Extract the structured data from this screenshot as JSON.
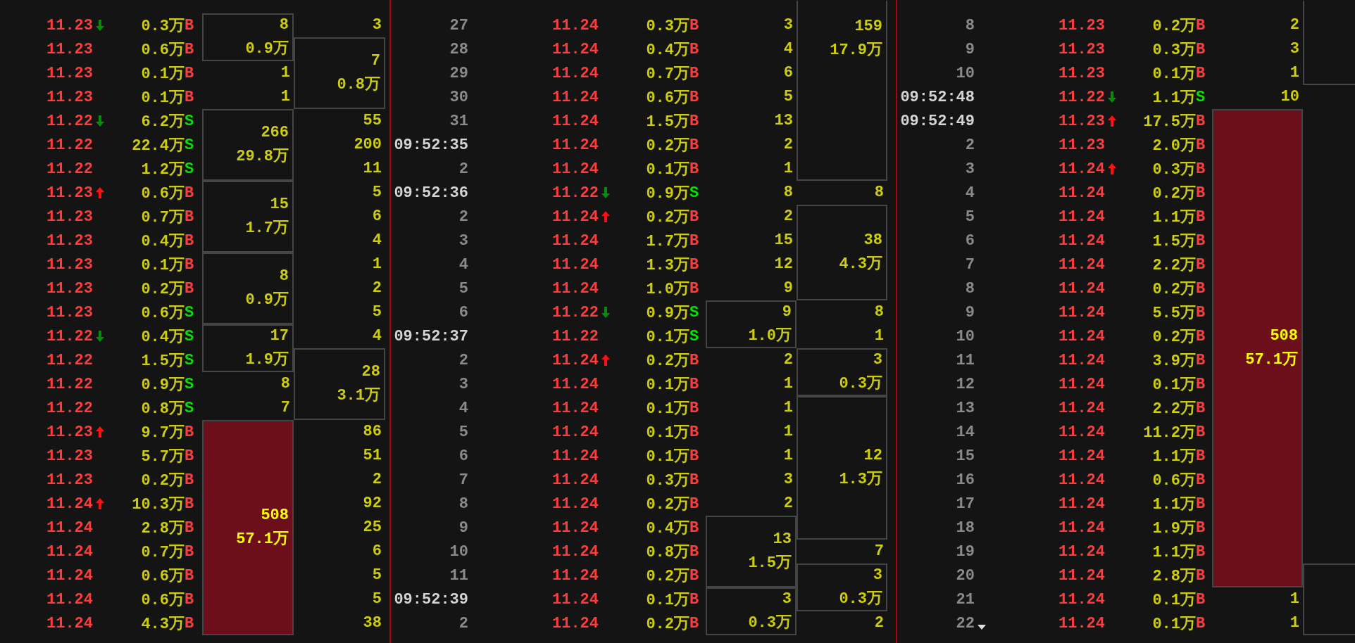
{
  "panels": [
    {
      "rows": [
        {
          "price": "11.23",
          "down_tick": true,
          "volume": "0.3万",
          "side": "B",
          "kind": "buy",
          "column_1": {
            "kind": "box",
            "count": "8",
            "amount": "0.9万"
          },
          "column_2": {
            "kind": "plain",
            "count": "3"
          }
        },
        {
          "price": "11.23",
          "volume": "0.6万",
          "side": "B",
          "kind": "buy",
          "column_2": {
            "kind": "box",
            "count": "7",
            "amount": "0.8万"
          }
        },
        {
          "price": "11.23",
          "volume": "0.1万",
          "side": "B",
          "kind": "buy",
          "column_1": {
            "kind": "plain",
            "count": "1"
          }
        },
        {
          "price": "11.23",
          "volume": "0.1万",
          "side": "B",
          "kind": "buy",
          "column_1": {
            "kind": "plain",
            "count": "1"
          }
        },
        {
          "price": "11.22",
          "down_tick": true,
          "volume": "6.2万",
          "side": "S",
          "kind": "sell",
          "column_1": {
            "kind": "box",
            "count": "266",
            "amount": "29.8万"
          },
          "column_2": {
            "kind": "plain",
            "count": "55"
          }
        },
        {
          "price": "11.22",
          "volume": "22.4万",
          "side": "S",
          "kind": "sell",
          "column_2": {
            "kind": "plain",
            "count": "200"
          }
        },
        {
          "price": "11.22",
          "volume": "1.2万",
          "side": "S",
          "kind": "sell",
          "column_2": {
            "kind": "plain",
            "count": "11"
          }
        },
        {
          "price": "11.23",
          "up_tick": true,
          "volume": "0.6万",
          "side": "B",
          "kind": "buy",
          "column_1": {
            "kind": "box",
            "count": "15",
            "amount": "1.7万"
          },
          "column_2": {
            "kind": "plain",
            "count": "5"
          }
        },
        {
          "price": "11.23",
          "volume": "0.7万",
          "side": "B",
          "kind": "buy",
          "column_2": {
            "kind": "plain",
            "count": "6"
          }
        },
        {
          "price": "11.23",
          "volume": "0.4万",
          "side": "B",
          "kind": "buy",
          "column_2": {
            "kind": "plain",
            "count": "4"
          }
        },
        {
          "price": "11.23",
          "volume": "0.1万",
          "side": "B",
          "kind": "buy",
          "column_1": {
            "kind": "box",
            "count": "8",
            "amount": "0.9万"
          },
          "column_2": {
            "kind": "plain",
            "count": "1"
          }
        },
        {
          "price": "11.23",
          "volume": "0.2万",
          "side": "B",
          "kind": "buy",
          "column_2": {
            "kind": "plain",
            "count": "2"
          }
        },
        {
          "price": "11.23",
          "volume": "0.6万",
          "side": "S",
          "kind": "sell",
          "column_2": {
            "kind": "plain",
            "count": "5"
          }
        },
        {
          "price": "11.22",
          "down_tick": true,
          "volume": "0.4万",
          "side": "S",
          "kind": "sell",
          "column_1": {
            "kind": "box",
            "count": "17",
            "amount": "1.9万"
          },
          "column_2": {
            "kind": "plain",
            "count": "4"
          }
        },
        {
          "price": "11.22",
          "volume": "1.5万",
          "side": "S",
          "kind": "sell",
          "column_2": {
            "kind": "box",
            "count": "28",
            "amount": "3.1万"
          }
        },
        {
          "price": "11.22",
          "volume": "0.9万",
          "side": "S",
          "kind": "sell",
          "column_1": {
            "kind": "plain",
            "count": "8"
          }
        },
        {
          "price": "11.22",
          "volume": "0.8万",
          "side": "S",
          "kind": "sell",
          "column_1": {
            "kind": "plain",
            "count": "7"
          }
        },
        {
          "price": "11.23",
          "up_tick": true,
          "volume": "9.7万",
          "side": "B",
          "kind": "buy",
          "column_1": {
            "kind": "highlight",
            "count": "508",
            "amount": "57.1万"
          },
          "column_2": {
            "kind": "plain",
            "count": "86"
          }
        },
        {
          "price": "11.23",
          "volume": "5.7万",
          "side": "B",
          "kind": "buy",
          "column_2": {
            "kind": "plain",
            "count": "51"
          }
        },
        {
          "price": "11.23",
          "volume": "0.2万",
          "side": "B",
          "kind": "buy",
          "column_2": {
            "kind": "plain",
            "count": "2"
          }
        },
        {
          "price": "11.24",
          "up_tick": true,
          "volume": "10.3万",
          "side": "B",
          "kind": "buy",
          "column_2": {
            "kind": "plain",
            "count": "92"
          }
        },
        {
          "price": "11.24",
          "volume": "2.8万",
          "side": "B",
          "kind": "buy",
          "column_2": {
            "kind": "plain",
            "count": "25"
          }
        },
        {
          "price": "11.24",
          "volume": "0.7万",
          "side": "B",
          "kind": "buy",
          "column_2": {
            "kind": "plain",
            "count": "6"
          }
        },
        {
          "price": "11.24",
          "volume": "0.6万",
          "side": "B",
          "kind": "buy",
          "column_2": {
            "kind": "plain",
            "count": "5"
          }
        },
        {
          "price": "11.24",
          "volume": "0.6万",
          "side": "B",
          "kind": "buy",
          "column_2": {
            "kind": "plain",
            "count": "5"
          }
        },
        {
          "price": "11.24",
          "volume": "4.3万",
          "side": "B",
          "kind": "buy",
          "column_2": {
            "kind": "plain",
            "count": "38"
          }
        }
      ]
    },
    {
      "rows": [
        {
          "time": "27",
          "price": "11.24",
          "volume": "0.3万",
          "side": "B",
          "kind": "buy",
          "column_1": {
            "kind": "plain",
            "count": "3"
          },
          "column_2": {
            "kind": "box",
            "count": "159",
            "amount": "17.9万",
            "continues_above": true
          }
        },
        {
          "time": "28",
          "price": "11.24",
          "volume": "0.4万",
          "side": "B",
          "kind": "buy",
          "column_1": {
            "kind": "plain",
            "count": "4"
          }
        },
        {
          "time": "29",
          "price": "11.24",
          "volume": "0.7万",
          "side": "B",
          "kind": "buy",
          "column_1": {
            "kind": "plain",
            "count": "6"
          }
        },
        {
          "time": "30",
          "price": "11.24",
          "volume": "0.6万",
          "side": "B",
          "kind": "buy",
          "column_1": {
            "kind": "plain",
            "count": "5"
          }
        },
        {
          "time": "31",
          "price": "11.24",
          "volume": "1.5万",
          "side": "B",
          "kind": "buy",
          "column_1": {
            "kind": "plain",
            "count": "13"
          }
        },
        {
          "time": "09:52:35",
          "new_second": true,
          "price": "11.24",
          "volume": "0.2万",
          "side": "B",
          "kind": "buy",
          "column_1": {
            "kind": "plain",
            "count": "2"
          }
        },
        {
          "time": "2",
          "price": "11.24",
          "volume": "0.1万",
          "side": "B",
          "kind": "buy",
          "column_1": {
            "kind": "plain",
            "count": "1"
          }
        },
        {
          "time": "09:52:36",
          "new_second": true,
          "price": "11.22",
          "down_tick": true,
          "volume": "0.9万",
          "side": "S",
          "kind": "sell",
          "column_1": {
            "kind": "plain",
            "count": "8"
          },
          "column_2": {
            "kind": "plain",
            "count": "8"
          }
        },
        {
          "time": "2",
          "price": "11.24",
          "up_tick": true,
          "volume": "0.2万",
          "side": "B",
          "kind": "buy",
          "column_1": {
            "kind": "plain",
            "count": "2"
          },
          "column_2": {
            "kind": "box",
            "count": "38",
            "amount": "4.3万"
          }
        },
        {
          "time": "3",
          "price": "11.24",
          "volume": "1.7万",
          "side": "B",
          "kind": "buy",
          "column_1": {
            "kind": "plain",
            "count": "15"
          }
        },
        {
          "time": "4",
          "price": "11.24",
          "volume": "1.3万",
          "side": "B",
          "kind": "buy",
          "column_1": {
            "kind": "plain",
            "count": "12"
          }
        },
        {
          "time": "5",
          "price": "11.24",
          "volume": "1.0万",
          "side": "B",
          "kind": "buy",
          "column_1": {
            "kind": "plain",
            "count": "9"
          }
        },
        {
          "time": "6",
          "price": "11.22",
          "down_tick": true,
          "volume": "0.9万",
          "side": "S",
          "kind": "sell",
          "column_1": {
            "kind": "box",
            "count": "9",
            "amount": "1.0万"
          },
          "column_2": {
            "kind": "plain",
            "count": "8"
          }
        },
        {
          "time": "09:52:37",
          "new_second": true,
          "price": "11.22",
          "volume": "0.1万",
          "side": "S",
          "kind": "sell",
          "column_2": {
            "kind": "plain",
            "count": "1"
          }
        },
        {
          "time": "2",
          "price": "11.24",
          "up_tick": true,
          "volume": "0.2万",
          "side": "B",
          "kind": "buy",
          "column_1": {
            "kind": "plain",
            "count": "2"
          },
          "column_2": {
            "kind": "box",
            "count": "3",
            "amount": "0.3万"
          }
        },
        {
          "time": "3",
          "price": "11.24",
          "volume": "0.1万",
          "side": "B",
          "kind": "buy",
          "column_1": {
            "kind": "plain",
            "count": "1"
          }
        },
        {
          "time": "4",
          "price": "11.24",
          "volume": "0.1万",
          "side": "B",
          "kind": "buy",
          "column_1": {
            "kind": "plain",
            "count": "1"
          },
          "column_2": {
            "kind": "box",
            "count": "12",
            "amount": "1.3万"
          }
        },
        {
          "time": "5",
          "price": "11.24",
          "volume": "0.1万",
          "side": "B",
          "kind": "buy",
          "column_1": {
            "kind": "plain",
            "count": "1"
          }
        },
        {
          "time": "6",
          "price": "11.24",
          "volume": "0.1万",
          "side": "B",
          "kind": "buy",
          "column_1": {
            "kind": "plain",
            "count": "1"
          }
        },
        {
          "time": "7",
          "price": "11.24",
          "volume": "0.3万",
          "side": "B",
          "kind": "buy",
          "column_1": {
            "kind": "plain",
            "count": "3"
          }
        },
        {
          "time": "8",
          "price": "11.24",
          "volume": "0.2万",
          "side": "B",
          "kind": "buy",
          "column_1": {
            "kind": "plain",
            "count": "2"
          }
        },
        {
          "time": "9",
          "price": "11.24",
          "volume": "0.4万",
          "side": "B",
          "kind": "buy",
          "column_1": {
            "kind": "box",
            "count": "13",
            "amount": "1.5万"
          }
        },
        {
          "time": "10",
          "price": "11.24",
          "volume": "0.8万",
          "side": "B",
          "kind": "buy",
          "column_2": {
            "kind": "plain",
            "count": "7"
          }
        },
        {
          "time": "11",
          "price": "11.24",
          "volume": "0.2万",
          "side": "B",
          "kind": "buy",
          "column_2": {
            "kind": "box",
            "count": "3",
            "amount": "0.3万"
          }
        },
        {
          "time": "09:52:39",
          "new_second": true,
          "price": "11.24",
          "volume": "0.1万",
          "side": "B",
          "kind": "buy",
          "column_1": {
            "kind": "box",
            "count": "3",
            "amount": "0.3万"
          }
        },
        {
          "time": "2",
          "price": "11.24",
          "volume": "0.2万",
          "side": "B",
          "kind": "buy",
          "column_2": {
            "kind": "plain",
            "count": "2"
          }
        }
      ]
    },
    {
      "rows": [
        {
          "time": "8",
          "price": "11.23",
          "volume": "0.2万",
          "side": "B",
          "kind": "buy",
          "column_1": {
            "kind": "plain",
            "count": "2"
          },
          "column_2": {
            "kind": "box",
            "continues_above": true
          }
        },
        {
          "time": "9",
          "price": "11.23",
          "volume": "0.3万",
          "side": "B",
          "kind": "buy",
          "column_1": {
            "kind": "plain",
            "count": "3"
          }
        },
        {
          "time": "10",
          "price": "11.23",
          "volume": "0.1万",
          "side": "B",
          "kind": "buy",
          "column_1": {
            "kind": "plain",
            "count": "1"
          }
        },
        {
          "time": "09:52:48",
          "new_second": true,
          "price": "11.22",
          "down_tick": true,
          "volume": "1.1万",
          "side": "S",
          "kind": "sell",
          "column_1": {
            "kind": "plain",
            "count": "10"
          },
          "column_2": {
            "kind": "blank"
          }
        },
        {
          "time": "09:52:49",
          "new_second": true,
          "price": "11.23",
          "up_tick": true,
          "volume": "17.5万",
          "side": "B",
          "kind": "buy",
          "column_1": {
            "kind": "highlight",
            "count": "508",
            "amount": "57.1万"
          }
        },
        {
          "time": "2",
          "price": "11.23",
          "volume": "2.0万",
          "side": "B",
          "kind": "buy"
        },
        {
          "time": "3",
          "price": "11.24",
          "up_tick": true,
          "volume": "0.3万",
          "side": "B",
          "kind": "buy"
        },
        {
          "time": "4",
          "price": "11.24",
          "volume": "0.2万",
          "side": "B",
          "kind": "buy"
        },
        {
          "time": "5",
          "price": "11.24",
          "volume": "1.1万",
          "side": "B",
          "kind": "buy"
        },
        {
          "time": "6",
          "price": "11.24",
          "volume": "1.5万",
          "side": "B",
          "kind": "buy"
        },
        {
          "time": "7",
          "price": "11.24",
          "volume": "2.2万",
          "side": "B",
          "kind": "buy"
        },
        {
          "time": "8",
          "price": "11.24",
          "volume": "0.2万",
          "side": "B",
          "kind": "buy"
        },
        {
          "time": "9",
          "price": "11.24",
          "volume": "5.5万",
          "side": "B",
          "kind": "buy"
        },
        {
          "time": "10",
          "price": "11.24",
          "volume": "0.2万",
          "side": "B",
          "kind": "buy"
        },
        {
          "time": "11",
          "price": "11.24",
          "volume": "3.9万",
          "side": "B",
          "kind": "buy"
        },
        {
          "time": "12",
          "price": "11.24",
          "volume": "0.1万",
          "side": "B",
          "kind": "buy"
        },
        {
          "time": "13",
          "price": "11.24",
          "volume": "2.2万",
          "side": "B",
          "kind": "buy"
        },
        {
          "time": "14",
          "price": "11.24",
          "volume": "11.2万",
          "side": "B",
          "kind": "buy"
        },
        {
          "time": "15",
          "price": "11.24",
          "volume": "1.1万",
          "side": "B",
          "kind": "buy"
        },
        {
          "time": "16",
          "price": "11.24",
          "volume": "0.6万",
          "side": "B",
          "kind": "buy"
        },
        {
          "time": "17",
          "price": "11.24",
          "volume": "1.1万",
          "side": "B",
          "kind": "buy"
        },
        {
          "time": "18",
          "price": "11.24",
          "volume": "1.9万",
          "side": "B",
          "kind": "buy"
        },
        {
          "time": "19",
          "price": "11.24",
          "volume": "1.1万",
          "side": "B",
          "kind": "buy"
        },
        {
          "time": "20",
          "price": "11.24",
          "volume": "2.8万",
          "side": "B",
          "kind": "buy",
          "column_2": {
            "kind": "box"
          }
        },
        {
          "time": "21",
          "price": "11.24",
          "volume": "0.1万",
          "side": "B",
          "kind": "buy",
          "column_1": {
            "kind": "plain",
            "count": "1"
          }
        },
        {
          "time": "22",
          "caret": true,
          "price": "11.24",
          "volume": "0.1万",
          "side": "B",
          "kind": "buy",
          "column_1": {
            "kind": "plain",
            "count": "1"
          }
        }
      ]
    }
  ]
}
